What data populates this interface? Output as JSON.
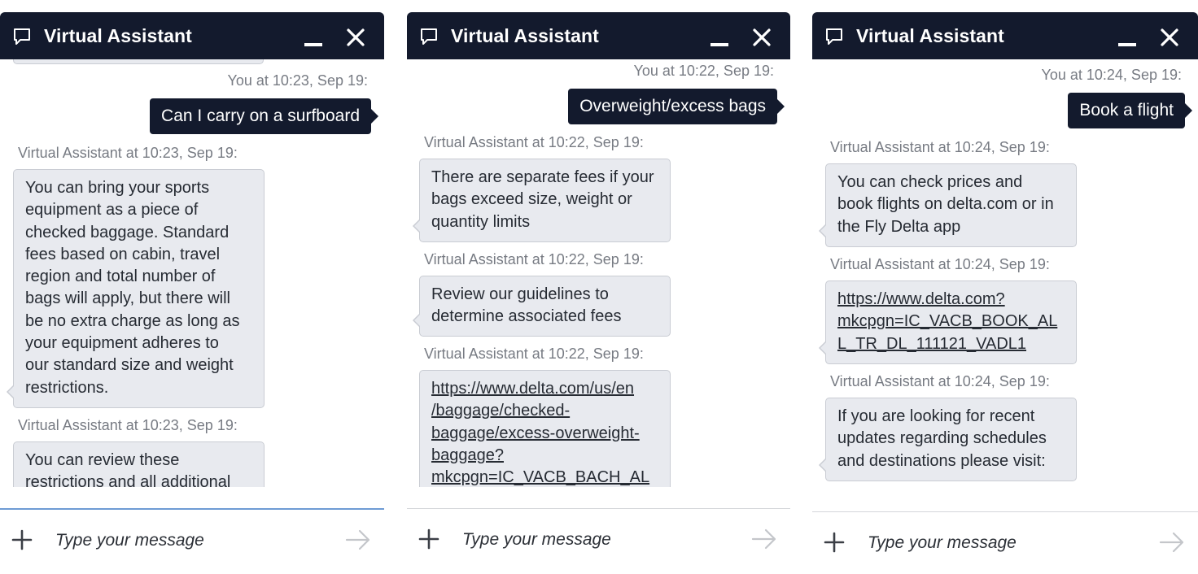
{
  "panels": [
    {
      "header": {
        "title": "Virtual Assistant"
      },
      "messages": [
        {
          "meta": "You at 10:23, Sep 19:",
          "text": "Can I carry on a surfboard"
        },
        {
          "meta": "Virtual Assistant at 10:23, Sep 19:",
          "text": "You can bring your sports\nequipment as a piece of\nchecked baggage. Standard\nfees based on cabin, travel\nregion and total number of\nbags will apply, but there will\nbe no extra charge as long as\nyour equipment adheres to\nour standard size and weight\nrestrictions."
        },
        {
          "meta": "Virtual Assistant at 10:23, Sep 19:",
          "text": "You can review these\nrestrictions and all additional"
        }
      ],
      "input": {
        "placeholder": "Type your message"
      }
    },
    {
      "header": {
        "title": "Virtual Assistant"
      },
      "messages": [
        {
          "meta": "You at 10:22, Sep 19:",
          "text": "Overweight/excess bags"
        },
        {
          "meta": "Virtual Assistant at 10:22, Sep 19:",
          "text": "There are separate fees if your\nbags exceed size, weight or\nquantity limits"
        },
        {
          "meta": "Virtual Assistant at 10:22, Sep 19:",
          "text": "Review our guidelines to\ndetermine associated fees"
        },
        {
          "meta": "Virtual Assistant at 10:22, Sep 19:",
          "text": "https://www.delta.com/us/en\n/baggage/checked-\nbaggage/excess-overweight-\nbaggage?\nmkcpgn=IC_VACB_BACH_AL"
        }
      ],
      "input": {
        "placeholder": "Type your message"
      }
    },
    {
      "header": {
        "title": "Virtual Assistant"
      },
      "messages": [
        {
          "meta": "You at 10:24, Sep 19:",
          "text": "Book a flight"
        },
        {
          "meta": "Virtual Assistant at 10:24, Sep 19:",
          "text": "You can check prices and\nbook flights on delta.com or in\nthe Fly Delta app"
        },
        {
          "meta": "Virtual Assistant at 10:24, Sep 19:",
          "text": "https://www.delta.com?\nmkcpgn=IC_VACB_BOOK_AL\nL_TR_DL_111121_VADL1"
        },
        {
          "meta": "Virtual Assistant at 10:24, Sep 19:",
          "text": "If you are looking for recent\nupdates regarding schedules\nand destinations please visit:"
        }
      ],
      "input": {
        "placeholder": "Type your message"
      }
    }
  ],
  "colors": {
    "header_bg": "#131a2d",
    "user_bubble_bg": "#131a2d",
    "bot_bubble_bg": "#e8eaef",
    "bot_bubble_border": "#c9ccd3",
    "meta_text": "#777b83",
    "input_focus_border": "#6e9bd4"
  },
  "icons": {
    "header": [
      "chat-bubble-icon",
      "minimize-icon",
      "close-icon"
    ],
    "input": [
      "plus-icon",
      "send-arrow-icon"
    ]
  }
}
